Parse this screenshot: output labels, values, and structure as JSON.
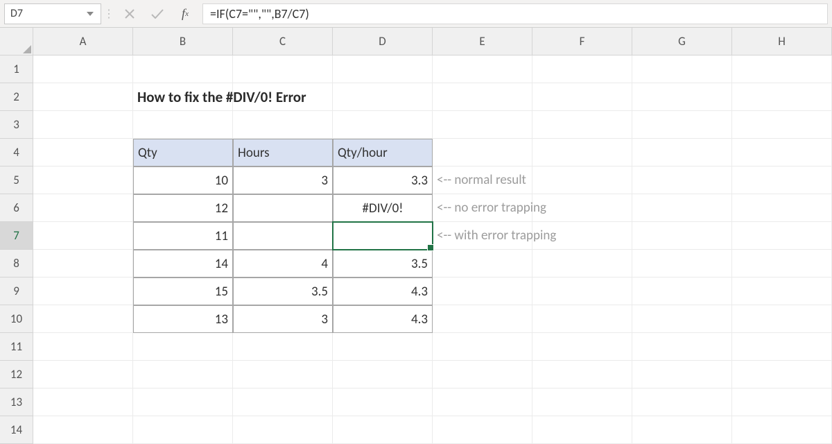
{
  "formula_bar": {
    "name_box": "D7",
    "formula": "=IF(C7=\"\",\"\",B7/C7)"
  },
  "columns": [
    "A",
    "B",
    "C",
    "D",
    "E",
    "F",
    "G",
    "H"
  ],
  "rows": [
    "1",
    "2",
    "3",
    "4",
    "5",
    "6",
    "7",
    "8",
    "9",
    "10",
    "11",
    "12",
    "13",
    "14"
  ],
  "title": "How to fix the #DIV/0! Error",
  "table": {
    "headers": {
      "b": "Qty",
      "c": "Hours",
      "d": "Qty/hour"
    },
    "rows": [
      {
        "b": "10",
        "c": "3",
        "d": "3.3",
        "ann": "<-- normal result"
      },
      {
        "b": "12",
        "c": "",
        "d": "#DIV/0!",
        "ann": "<-- no error trapping"
      },
      {
        "b": "11",
        "c": "",
        "d": "",
        "ann": "<-- with error trapping"
      },
      {
        "b": "14",
        "c": "4",
        "d": "3.5",
        "ann": ""
      },
      {
        "b": "15",
        "c": "3.5",
        "d": "4.3",
        "ann": ""
      },
      {
        "b": "13",
        "c": "3",
        "d": "4.3",
        "ann": ""
      }
    ]
  },
  "selected_cell": "D7",
  "chart_data": {
    "type": "table",
    "title": "How to fix the #DIV/0! Error",
    "columns": [
      "Qty",
      "Hours",
      "Qty/hour"
    ],
    "rows": [
      [
        10,
        3,
        3.3
      ],
      [
        12,
        null,
        "#DIV/0!"
      ],
      [
        11,
        null,
        ""
      ],
      [
        14,
        4,
        3.5
      ],
      [
        15,
        3.5,
        4.3
      ],
      [
        13,
        3,
        4.3
      ]
    ],
    "annotations": [
      "normal result",
      "no error trapping",
      "with error trapping",
      "",
      "",
      ""
    ]
  }
}
